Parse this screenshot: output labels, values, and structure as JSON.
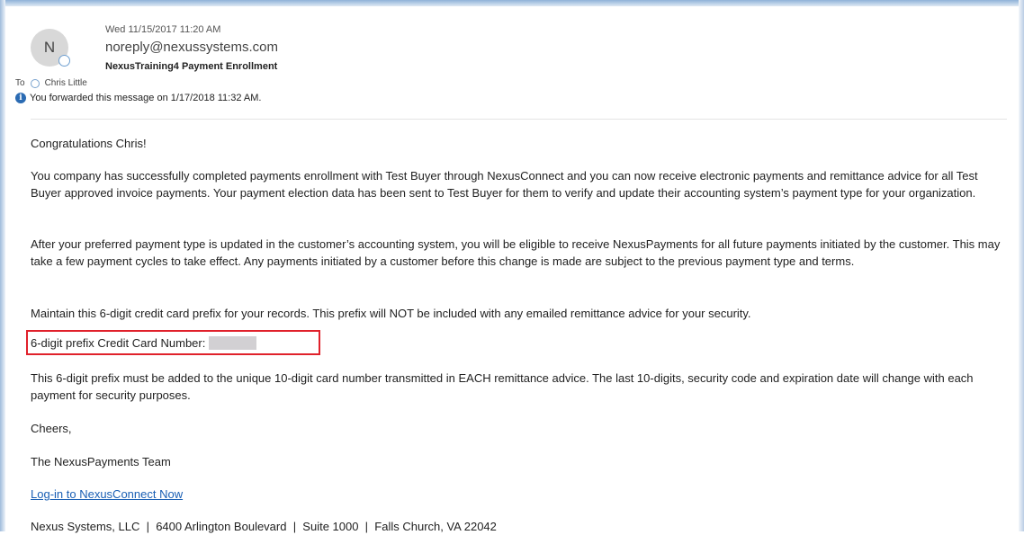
{
  "header": {
    "avatar_initial": "N",
    "date": "Wed 11/15/2017 11:20 AM",
    "from": "noreply@nexussystems.com",
    "subject": "NexusTraining4 Payment Enrollment",
    "to_label": "To",
    "to_recipient": "Chris Little",
    "info_text": "You forwarded this message on 1/17/2018 11:32 AM."
  },
  "body": {
    "greeting": "Congratulations Chris!",
    "paragraph1": "You company has successfully completed payments enrollment with Test Buyer through NexusConnect and you can now receive electronic payments and remittance advice for all Test Buyer approved invoice payments. Your payment election data has been sent to Test Buyer for them to verify and update their accounting system’s payment type for your organization.",
    "paragraph2": "After your preferred payment type is updated in the customer’s accounting system, you will be eligible to receive NexusPayments for all future payments initiated by the customer. This may take a few payment cycles to take effect. Any payments initiated by a customer before this change is made are subject to the previous payment type and terms.",
    "paragraph3": "Maintain this 6-digit credit card prefix for your records. This prefix will NOT be included with any emailed remittance advice for your security.",
    "prefix_label": "6-digit prefix Credit Card Number:",
    "paragraph4": "This 6-digit prefix must be added to the unique 10-digit card number transmitted in EACH remittance advice. The last 10-digits, security code and expiration date will change with each payment for security purposes.",
    "cheers": "Cheers,",
    "signature": "The NexusPayments Team",
    "login_link": "Log-in to NexusConnect Now",
    "footer": "Nexus Systems, LLC  |  6400 Arlington Boulevard  |  Suite 1000  |  Falls Church, VA 22042"
  },
  "colors": {
    "link": "#1a5fb4",
    "highlight_box": "#e0212b",
    "info_icon": "#2b6bb3"
  }
}
